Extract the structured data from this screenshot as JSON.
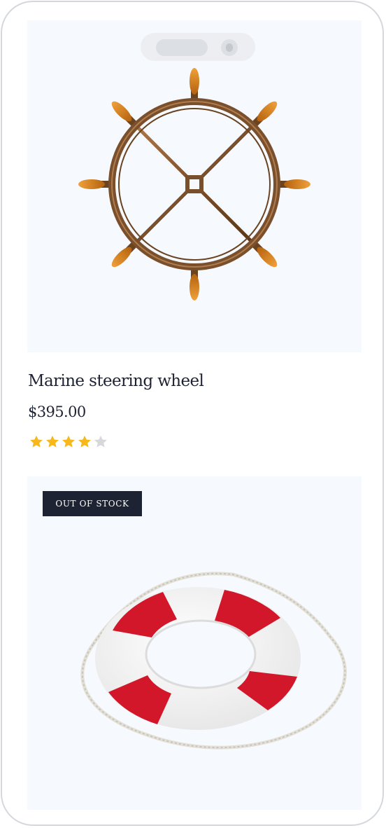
{
  "products": [
    {
      "image": {
        "icon": "ship-steering-wheel-icon"
      },
      "title": "Marine steering wheel",
      "price": "$395.00",
      "rating": {
        "value": 4,
        "max": 5
      }
    },
    {
      "badge": "OUT OF STOCK",
      "image": {
        "icon": "life-buoy-icon"
      }
    }
  ],
  "colors": {
    "star_filled": "#f6b81a",
    "star_empty": "#d6d8dc",
    "badge_bg": "#1d2333",
    "image_bg": "#f6f9fd"
  }
}
